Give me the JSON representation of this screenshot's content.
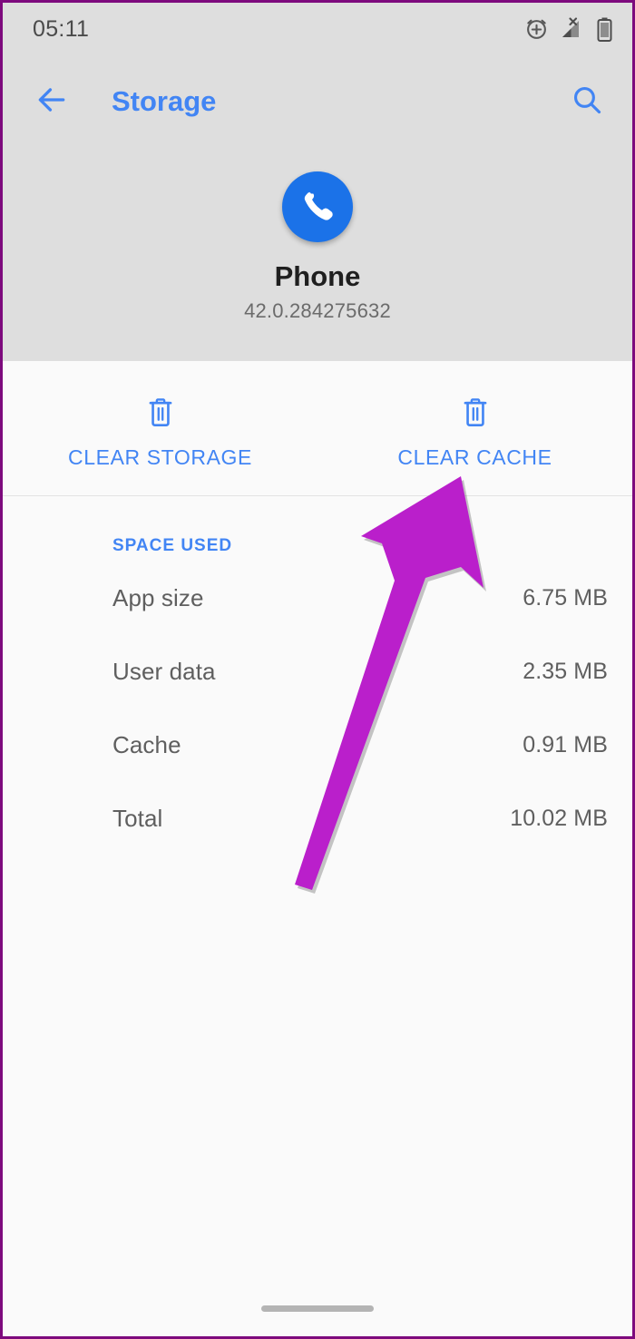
{
  "status_bar": {
    "time": "05:11",
    "icons": [
      "alarm-plus-icon",
      "signal-no-sim-icon",
      "battery-icon"
    ]
  },
  "app_bar": {
    "back_icon": "back-arrow-icon",
    "title": "Storage",
    "search_icon": "search-icon"
  },
  "app_identity": {
    "icon": "phone-app-icon",
    "name": "Phone",
    "version": "42.0.284275632"
  },
  "actions": [
    {
      "icon": "trash-icon",
      "label": "CLEAR STORAGE"
    },
    {
      "icon": "trash-icon",
      "label": "CLEAR CACHE"
    }
  ],
  "space_used": {
    "section_title": "SPACE USED",
    "rows": [
      {
        "label": "App size",
        "value": "6.75 MB"
      },
      {
        "label": "User data",
        "value": "2.35 MB"
      },
      {
        "label": "Cache",
        "value": "0.91 MB"
      },
      {
        "label": "Total",
        "value": "10.02 MB"
      }
    ]
  },
  "annotation": {
    "type": "arrow",
    "points_to": "CLEAR CACHE",
    "color": "#ba1fcb"
  },
  "colors": {
    "accent_blue": "#4285f4",
    "app_icon_blue": "#1b72e8",
    "header_background": "#dedede",
    "page_background": "#fafafa",
    "text_primary": "#1f1f1f",
    "text_secondary": "#5f5f5f",
    "screenshot_border": "#7d0a7d"
  },
  "home_indicator": "gesture-home-bar"
}
